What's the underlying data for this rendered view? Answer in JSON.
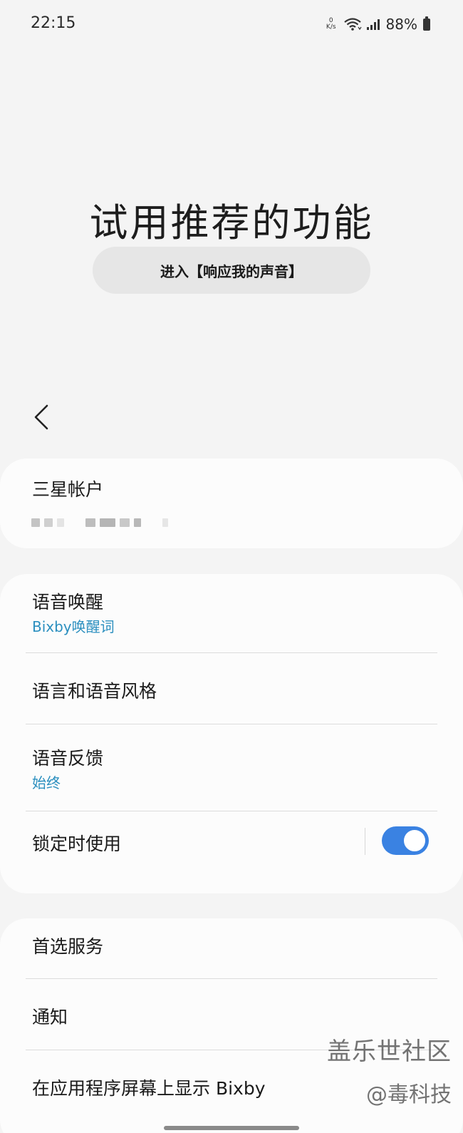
{
  "status_bar": {
    "time": "22:15",
    "net_speed_value": "0",
    "net_speed_unit": "K/s",
    "battery": "88%"
  },
  "hero": {
    "title": "试用推荐的功能",
    "button_label": "进入【响应我的声音】"
  },
  "account": {
    "title": "三星帐户"
  },
  "voice": {
    "wake_title": "语音唤醒",
    "wake_sub": "Bixby唤醒词",
    "language_title": "语言和语音风格",
    "feedback_title": "语音反馈",
    "feedback_sub": "始终",
    "lock_title": "锁定时使用",
    "lock_enabled": true
  },
  "services": {
    "preferred_title": "首选服务",
    "notify_title": "通知",
    "show_bixby_title": "在应用程序屏幕上显示 Bixby"
  },
  "watermark": {
    "line1": "盖乐世社区",
    "line2": "@毒科技"
  },
  "colors": {
    "accent": "#3a82e2",
    "subtitle": "#2b8fbf",
    "background": "#f4f4f4",
    "card": "#fcfcfc"
  }
}
